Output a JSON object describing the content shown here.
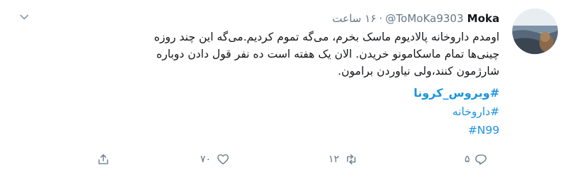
{
  "tweet": {
    "author_name": "Moka",
    "handle": "@ToMoKa9303",
    "separator": "·",
    "time": "۱۶ ساعت",
    "body_lines": [
      "اومدم داروخانه پالادیوم ماسک بخرم، می‌گه تموم کردیم.می‌گه این چند روزه",
      "چینی‌ها تمام ماسکامونو خریدن. الان یک هفته است ده نفر قول دادن دوباره",
      "شارژمون کنند،ولی نیاوردن برامون."
    ],
    "hashtags": [
      "#ویروس_کرونا",
      "#داروخانه",
      "#N99"
    ]
  },
  "actions": {
    "reply_count": "۵",
    "retweet_count": "۱۲",
    "like_count": "۷۰"
  },
  "icons": {
    "more": "chevron-down-icon",
    "reply": "reply-icon",
    "retweet": "retweet-icon",
    "like": "heart-icon",
    "share": "share-icon"
  },
  "colors": {
    "link": "#1b95e0",
    "secondary_text": "#657786",
    "primary_text": "#14171a"
  }
}
